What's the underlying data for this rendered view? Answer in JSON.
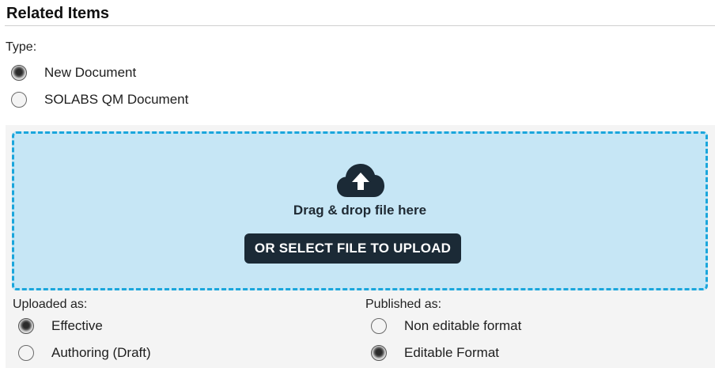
{
  "section": {
    "title": "Related Items"
  },
  "type_group": {
    "label": "Type:",
    "options": [
      {
        "label": "New Document",
        "selected": true
      },
      {
        "label": "SOLABS QM Document",
        "selected": false
      }
    ]
  },
  "upload": {
    "icon": "cloud-upload-icon",
    "drop_text": "Drag & drop file here",
    "button_label": "OR SELECT FILE TO UPLOAD",
    "accent_color": "#1aa6dc",
    "zone_color": "#c6e6f5",
    "button_color": "#1b2a36"
  },
  "uploaded_as": {
    "label": "Uploaded as:",
    "options": [
      {
        "label": "Effective",
        "selected": true
      },
      {
        "label": "Authoring (Draft)",
        "selected": false
      }
    ]
  },
  "published_as": {
    "label": "Published as:",
    "options": [
      {
        "label": "Non editable format",
        "selected": false
      },
      {
        "label": "Editable Format",
        "selected": true
      }
    ]
  }
}
